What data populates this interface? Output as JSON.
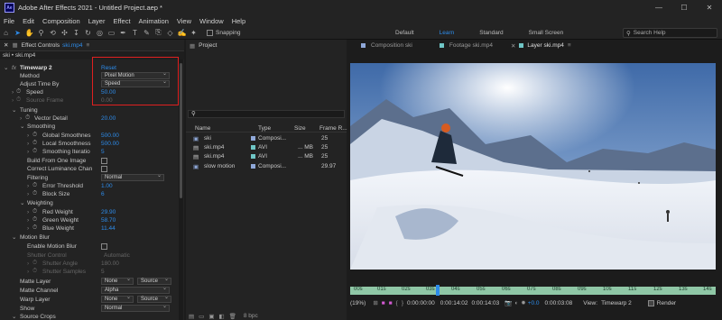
{
  "window": {
    "title": "Adobe After Effects 2021 - Untitled Project.aep *",
    "logo": "Ae"
  },
  "menu": [
    "File",
    "Edit",
    "Composition",
    "Layer",
    "Effect",
    "Animation",
    "View",
    "Window",
    "Help"
  ],
  "toolbar": {
    "snapping_label": "Snapping"
  },
  "workspaces": [
    {
      "label": "Default",
      "active": false
    },
    {
      "label": "Learn",
      "active": true
    },
    {
      "label": "Standard",
      "active": false
    },
    {
      "label": "Small Screen",
      "active": false
    }
  ],
  "search_help": {
    "placeholder": "Search Help"
  },
  "effect_controls": {
    "tab_label": "Effect Controls",
    "tab_file": "ski.mp4",
    "breadcrumb": "ski • ski.mp4",
    "effect_name": "Timewarp 2",
    "reset_label": "Reset",
    "rows": {
      "method": {
        "label": "Method",
        "value": "Pixel Motion"
      },
      "adjust_time_by": {
        "label": "Adjust Time By",
        "value": "Speed"
      },
      "speed": {
        "label": "Speed",
        "value": "50.00"
      },
      "source_frame": {
        "label": "Source Frame",
        "value": "0.00"
      },
      "tuning": {
        "label": "Tuning"
      },
      "vector_detail": {
        "label": "Vector Detail",
        "value": "20.00"
      },
      "smoothing": {
        "label": "Smoothing"
      },
      "global_smoothness": {
        "label": "Global Smoothnes",
        "value": "500.00"
      },
      "local_smoothness": {
        "label": "Local Smoothness",
        "value": "500.00"
      },
      "smoothing_iterations": {
        "label": "Smoothing Iteratio",
        "value": "5"
      },
      "build_from_one_image": {
        "label": "Build From One Image"
      },
      "correct_luminance": {
        "label": "Correct Luminance Chan"
      },
      "filtering": {
        "label": "Filtering",
        "value": "Normal"
      },
      "error_threshold": {
        "label": "Error Threshold",
        "value": "1.00"
      },
      "block_size": {
        "label": "Block Size",
        "value": "6"
      },
      "weighting": {
        "label": "Weighting"
      },
      "red_weight": {
        "label": "Red Weight",
        "value": "29.90"
      },
      "green_weight": {
        "label": "Green Weight",
        "value": "58.70"
      },
      "blue_weight": {
        "label": "Blue Weight",
        "value": "11.44"
      },
      "motion_blur": {
        "label": "Motion Blur"
      },
      "enable_motion_blur": {
        "label": "Enable Motion Blur"
      },
      "shutter_control": {
        "label": "Shutter Control",
        "value": "Automatic"
      },
      "shutter_angle": {
        "label": "Shutter Angle",
        "value": "180.00"
      },
      "shutter_samples": {
        "label": "Shutter Samples",
        "value": "5"
      },
      "matte_layer": {
        "label": "Matte Layer",
        "value": "None",
        "value2": "Source"
      },
      "matte_channel": {
        "label": "Matte Channel",
        "value": "Alpha"
      },
      "warp_layer": {
        "label": "Warp Layer",
        "value": "None",
        "value2": "Source"
      },
      "show": {
        "label": "Show",
        "value": "Normal"
      },
      "source_crops": {
        "label": "Source Crops"
      }
    }
  },
  "project": {
    "tab_label": "Project",
    "columns": [
      "Name",
      "Type",
      "Size",
      "Frame R..."
    ],
    "items": [
      {
        "name": "ski",
        "type": "Composi...",
        "size": "",
        "fps": "25",
        "color": "#8fa8d8"
      },
      {
        "name": "ski.mp4",
        "type": "AVI",
        "size": "... MB",
        "fps": "25",
        "color": "#6fc6c6"
      },
      {
        "name": "ski.mp4",
        "type": "AVI",
        "size": "... MB",
        "fps": "25",
        "color": "#6fc6c6"
      },
      {
        "name": "slow motion",
        "type": "Composi...",
        "size": "",
        "fps": "29.97",
        "color": "#8fa8d8"
      }
    ],
    "bpc": "8 bpc"
  },
  "viewer": {
    "tabs": [
      {
        "label": "Composition ski",
        "active": false
      },
      {
        "label": "Footage ski.mp4",
        "active": false
      },
      {
        "label": "Layer ski.mp4",
        "active": true
      }
    ],
    "ruler": [
      "00s",
      "01s",
      "02s",
      "03s",
      "04s",
      "05s",
      "06s",
      "07s",
      "08s",
      "09s",
      "10s",
      "11s",
      "12s",
      "13s",
      "14s"
    ],
    "playhead_fraction": 0.235,
    "status": {
      "zoom": "(19%)",
      "time_start": "0:00:00:00",
      "time_end": "0:00:14:02",
      "duration": "0:00:14:03",
      "offset": "+0.0",
      "current": "0:00:03:08",
      "view_label": "View:",
      "view_value": "Timewarp 2",
      "render_label": "Render"
    }
  }
}
